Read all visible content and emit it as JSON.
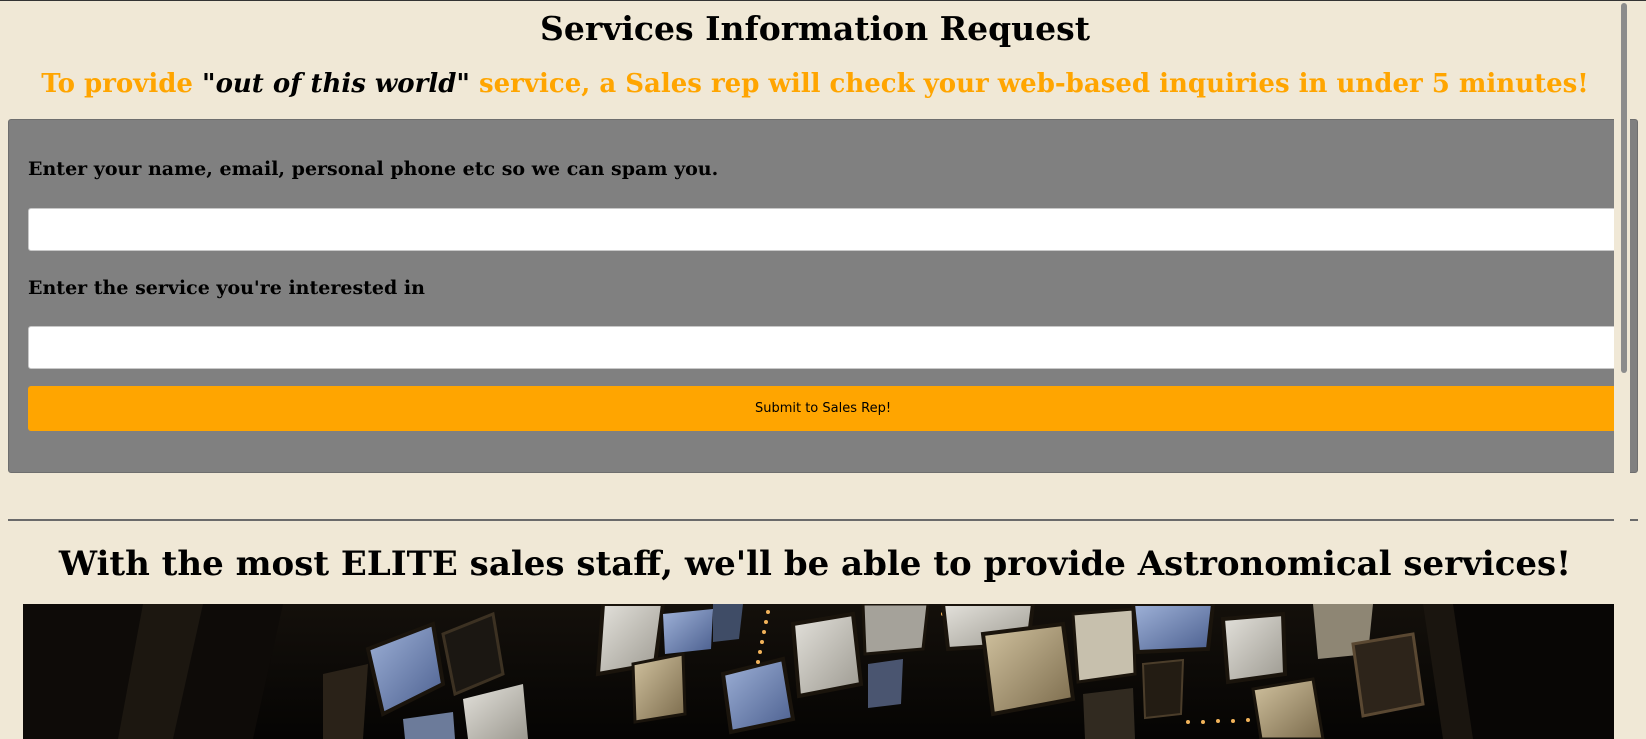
{
  "page": {
    "title": "Services Information Request",
    "tagline": {
      "part1": "To provide ",
      "quote_open": "\"",
      "emphasis": "out of this world",
      "quote_close": "\"",
      "part2": " service, a Sales rep will check your web-based inquiries in under 5 minutes!"
    },
    "accent_color": "#ffa500",
    "background_color": "#f0e8d6"
  },
  "form": {
    "panel_color": "#808080",
    "contact_label": "Enter your name, email, personal phone etc so we can spam you.",
    "contact_value": "",
    "service_label": "Enter the service you're interested in",
    "service_value": "",
    "submit_label": "Submit to Sales Rep!"
  },
  "section": {
    "headline": "With the most ELITE sales staff, we'll be able to provide Astronomical services!",
    "hero_image": "control-room-monitors-photo"
  }
}
